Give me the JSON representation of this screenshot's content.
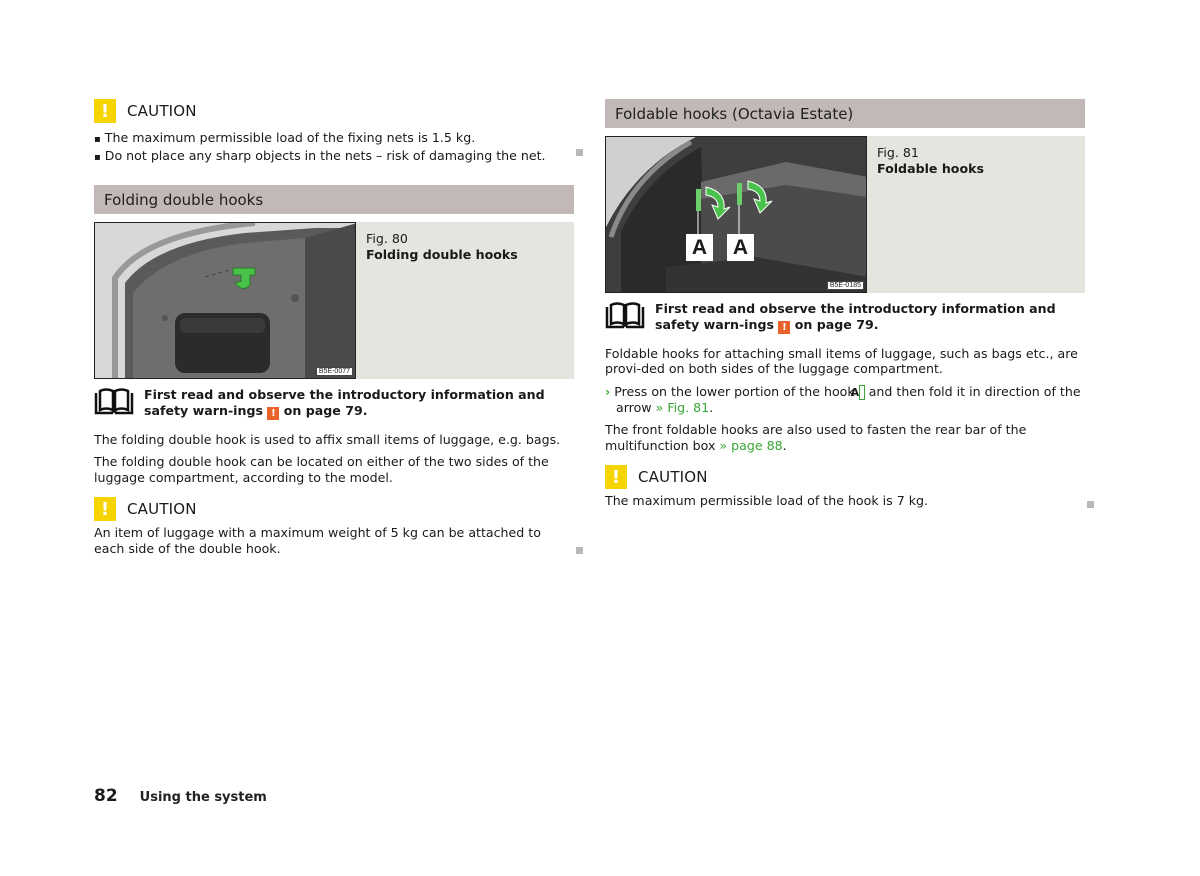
{
  "left": {
    "caution1": {
      "icon": "!",
      "title": "CAUTION",
      "bullets": [
        "The maximum permissible load of the fixing nets is 1.5 kg.",
        "Do not place any sharp objects in the nets – risk of damaging the net."
      ]
    },
    "section": {
      "title": "Folding double hooks",
      "figure": {
        "number": "Fig. 80",
        "caption": "Folding double hooks",
        "code": "B5E-0077"
      },
      "note": {
        "text_before": "First read and observe the introductory information and safety warn-ings",
        "icon": "!",
        "text_after": "on page 79."
      },
      "paragraphs": [
        "The folding double hook is used to affix small items of luggage, e.g. bags.",
        "The folding double hook can be located on either of the two sides of the luggage compartment, according to the model."
      ],
      "caution": {
        "icon": "!",
        "title": "CAUTION",
        "text": "An item of luggage with a maximum weight of 5 kg can be attached to each side of the double hook."
      }
    }
  },
  "right": {
    "section": {
      "title": "Foldable hooks (Octavia Estate)",
      "figure": {
        "number": "Fig. 81",
        "caption": "Foldable hooks",
        "code": "B5E-0185",
        "labels": [
          "A",
          "A"
        ]
      },
      "note": {
        "text_before": "First read and observe the introductory information and safety warn-ings",
        "icon": "!",
        "text_after": "on page 79."
      },
      "para1": "Foldable hooks for attaching small items of luggage, such as bags etc., are provi-ded on both sides of the luggage compartment.",
      "step": {
        "arrow": "›",
        "text_before": "Press on the lower portion of the hook",
        "label": "A",
        "text_middle": "and then fold it in direction of the arrow",
        "link": "» Fig. 81",
        "text_end": "."
      },
      "para2": {
        "text": "The front foldable hooks are also used to fasten the rear bar of the multifunction box",
        "link": "» page 88",
        "text_end": "."
      },
      "caution": {
        "icon": "!",
        "title": "CAUTION",
        "text": "The maximum permissible load of the hook is 7 kg."
      }
    }
  },
  "footer": {
    "page_number": "82",
    "chapter": "Using the system"
  }
}
